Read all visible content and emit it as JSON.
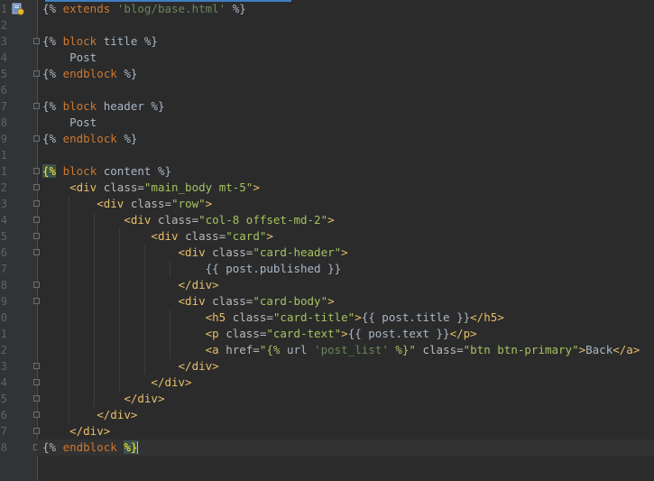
{
  "colors": {
    "background": "#2b2b2b",
    "gutter": "#313335",
    "tag": "#e8bf6a",
    "string": "#a5c261",
    "keyword": "#cc7832",
    "text": "#a9b7c6"
  },
  "gutter": {
    "file_icon": "django-template-icon",
    "line_numbers": [
      "1",
      "2",
      "3",
      "4",
      "5",
      "6",
      "7",
      "8",
      "9",
      "1",
      "1",
      "2",
      "3",
      "4",
      "5",
      "6",
      "7",
      "8",
      "9",
      "0",
      "1",
      "2",
      "3",
      "4",
      "5",
      "6",
      "7",
      "8"
    ]
  },
  "lines": [
    [
      {
        "t": "{% ",
        "c": "t-plain"
      },
      {
        "t": "extends ",
        "c": "t-kw"
      },
      {
        "t": "'blog/base.html'",
        "c": "t-squote"
      },
      {
        "t": " %}",
        "c": "t-plain"
      }
    ],
    [],
    [
      {
        "t": "{% ",
        "c": "t-plain"
      },
      {
        "t": "block ",
        "c": "t-kw"
      },
      {
        "t": "title %}",
        "c": "t-plain"
      }
    ],
    [
      {
        "t": "    Post",
        "c": "t-plain"
      }
    ],
    [
      {
        "t": "{% ",
        "c": "t-plain"
      },
      {
        "t": "endblock",
        "c": "t-kw"
      },
      {
        "t": " %}",
        "c": "t-plain"
      }
    ],
    [],
    [
      {
        "t": "{% ",
        "c": "t-plain"
      },
      {
        "t": "block ",
        "c": "t-kw"
      },
      {
        "t": "header %}",
        "c": "t-plain"
      }
    ],
    [
      {
        "t": "    Post",
        "c": "t-plain"
      }
    ],
    [
      {
        "t": "{% ",
        "c": "t-plain"
      },
      {
        "t": "endblock",
        "c": "t-kw"
      },
      {
        "t": " %}",
        "c": "t-plain"
      }
    ],
    [],
    [
      {
        "t": "{%",
        "c": "t-brace-yellow"
      },
      {
        "t": " ",
        "c": "t-plain"
      },
      {
        "t": "block ",
        "c": "t-kw"
      },
      {
        "t": "content %}",
        "c": "t-plain"
      }
    ],
    [
      {
        "t": "    ",
        "c": "t-plain"
      },
      {
        "t": "<div ",
        "c": "t-tag"
      },
      {
        "t": "class=",
        "c": "t-attr"
      },
      {
        "t": "\"main_body mt-5\"",
        "c": "t-str"
      },
      {
        "t": ">",
        "c": "t-tag"
      }
    ],
    [
      {
        "t": "        ",
        "c": "t-plain"
      },
      {
        "t": "<div ",
        "c": "t-tag"
      },
      {
        "t": "class=",
        "c": "t-attr"
      },
      {
        "t": "\"row\"",
        "c": "t-str"
      },
      {
        "t": ">",
        "c": "t-tag"
      }
    ],
    [
      {
        "t": "            ",
        "c": "t-plain"
      },
      {
        "t": "<div ",
        "c": "t-tag"
      },
      {
        "t": "class=",
        "c": "t-attr"
      },
      {
        "t": "\"col-8 offset-md-2\"",
        "c": "t-str"
      },
      {
        "t": ">",
        "c": "t-tag"
      }
    ],
    [
      {
        "t": "                ",
        "c": "t-plain"
      },
      {
        "t": "<div ",
        "c": "t-tag"
      },
      {
        "t": "class=",
        "c": "t-attr"
      },
      {
        "t": "\"card\"",
        "c": "t-str"
      },
      {
        "t": ">",
        "c": "t-tag"
      }
    ],
    [
      {
        "t": "                    ",
        "c": "t-plain"
      },
      {
        "t": "<div ",
        "c": "t-tag"
      },
      {
        "t": "class=",
        "c": "t-attr"
      },
      {
        "t": "\"card-header\"",
        "c": "t-str"
      },
      {
        "t": ">",
        "c": "t-tag"
      }
    ],
    [
      {
        "t": "                        {{ post.published }}",
        "c": "t-plain"
      }
    ],
    [
      {
        "t": "                    ",
        "c": "t-plain"
      },
      {
        "t": "</div>",
        "c": "t-tag"
      }
    ],
    [
      {
        "t": "                    ",
        "c": "t-plain"
      },
      {
        "t": "<div ",
        "c": "t-tag"
      },
      {
        "t": "class=",
        "c": "t-attr"
      },
      {
        "t": "\"card-body\"",
        "c": "t-str"
      },
      {
        "t": ">",
        "c": "t-tag"
      }
    ],
    [
      {
        "t": "                        ",
        "c": "t-plain"
      },
      {
        "t": "<h5 ",
        "c": "t-tag"
      },
      {
        "t": "class=",
        "c": "t-attr"
      },
      {
        "t": "\"card-title\"",
        "c": "t-str"
      },
      {
        "t": ">",
        "c": "t-tag"
      },
      {
        "t": "{{ post.title }}",
        "c": "t-plain"
      },
      {
        "t": "</h5>",
        "c": "t-tag"
      }
    ],
    [
      {
        "t": "                        ",
        "c": "t-plain"
      },
      {
        "t": "<p ",
        "c": "t-tag"
      },
      {
        "t": "class=",
        "c": "t-attr"
      },
      {
        "t": "\"card-text\"",
        "c": "t-str"
      },
      {
        "t": ">",
        "c": "t-tag"
      },
      {
        "t": "{{ post.text }}",
        "c": "t-plain"
      },
      {
        "t": "</p>",
        "c": "t-tag"
      }
    ],
    [
      {
        "t": "                        ",
        "c": "t-plain"
      },
      {
        "t": "<a ",
        "c": "t-tag"
      },
      {
        "t": "href=",
        "c": "t-attr"
      },
      {
        "t": "\"{% ",
        "c": "t-str"
      },
      {
        "t": "url ",
        "c": "t-plain"
      },
      {
        "t": "'post_list'",
        "c": "t-squote"
      },
      {
        "t": " %}\"",
        "c": "t-str"
      },
      {
        "t": " class=",
        "c": "t-attr"
      },
      {
        "t": "\"btn btn-primary\"",
        "c": "t-str"
      },
      {
        "t": ">",
        "c": "t-tag"
      },
      {
        "t": "Back",
        "c": "t-plain"
      },
      {
        "t": "</a>",
        "c": "t-tag"
      }
    ],
    [
      {
        "t": "                    ",
        "c": "t-plain"
      },
      {
        "t": "</div>",
        "c": "t-tag"
      }
    ],
    [
      {
        "t": "                ",
        "c": "t-plain"
      },
      {
        "t": "</div>",
        "c": "t-tag"
      }
    ],
    [
      {
        "t": "            ",
        "c": "t-plain"
      },
      {
        "t": "</div>",
        "c": "t-tag"
      }
    ],
    [
      {
        "t": "        ",
        "c": "t-plain"
      },
      {
        "t": "</div>",
        "c": "t-tag"
      }
    ],
    [
      {
        "t": "    ",
        "c": "t-plain"
      },
      {
        "t": "</div>",
        "c": "t-tag"
      }
    ],
    [
      {
        "t": "{% ",
        "c": "t-plain"
      },
      {
        "t": "endblock",
        "c": "t-kw"
      },
      {
        "t": " ",
        "c": "t-plain"
      },
      {
        "t": "%}",
        "c": "t-brace-yellow"
      }
    ]
  ],
  "folds": [
    2,
    4,
    6,
    8,
    10,
    11,
    12,
    13,
    14,
    15,
    17,
    18,
    22,
    23,
    24,
    25,
    26,
    27
  ],
  "current_line": 27
}
